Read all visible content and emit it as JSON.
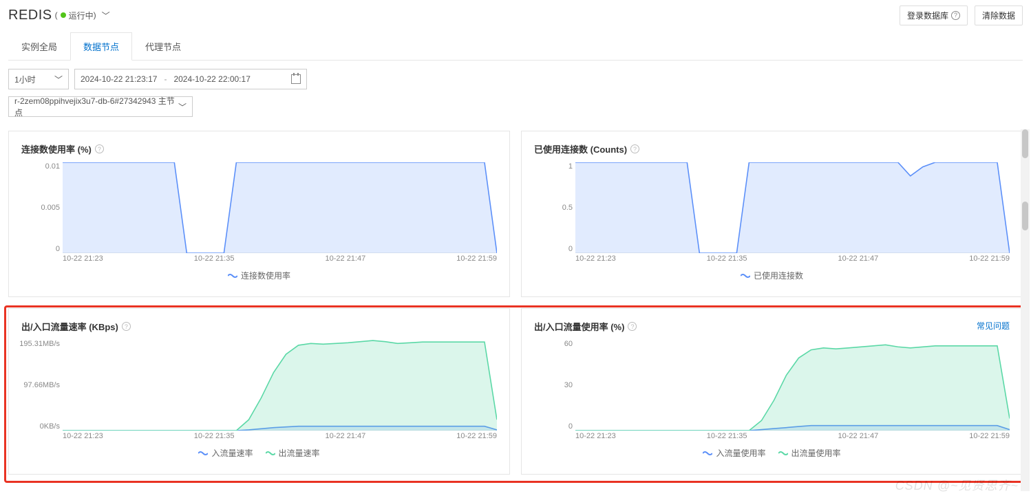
{
  "header": {
    "title": "REDIS",
    "status_text": "运行中",
    "login_btn": "登录数据库",
    "clear_btn": "清除数据"
  },
  "tabs": [
    {
      "label": "实例全局",
      "active": false
    },
    {
      "label": "数据节点",
      "active": true
    },
    {
      "label": "代理节点",
      "active": false
    }
  ],
  "filters": {
    "period": "1小时",
    "start": "2024-10-22 21:23:17",
    "end": "2024-10-22 22:00:17",
    "node": "r-2zem08ppihvejix3u7-db-6#27342943 主节点"
  },
  "faq_label": "常见问题",
  "watermark": "CSDN @~见贤思齐~",
  "chart_data": [
    {
      "id": "conn_rate",
      "type": "area",
      "title": "连接数使用率 (%)",
      "ylabel": "",
      "xlabel": "",
      "y_ticks": [
        "0.01",
        "0.005",
        "0"
      ],
      "x_ticks": [
        "10-22 21:23",
        "10-22 21:35",
        "10-22 21:47",
        "10-22 21:59"
      ],
      "ylim": [
        0,
        0.01
      ],
      "series": [
        {
          "name": "连接数使用率",
          "color": "#5b8ff9",
          "values": [
            0.01,
            0.01,
            0.01,
            0.01,
            0.01,
            0.01,
            0.01,
            0.01,
            0.01,
            0.01,
            0.0,
            0.0,
            0.0,
            0.0,
            0.01,
            0.01,
            0.01,
            0.01,
            0.01,
            0.01,
            0.01,
            0.01,
            0.01,
            0.01,
            0.01,
            0.01,
            0.01,
            0.01,
            0.01,
            0.01,
            0.01,
            0.01,
            0.01,
            0.01,
            0.01,
            0.0
          ]
        }
      ]
    },
    {
      "id": "conn_used",
      "type": "area",
      "title": "已使用连接数 (Counts)",
      "y_ticks": [
        "1",
        "0.5",
        "0"
      ],
      "x_ticks": [
        "10-22 21:23",
        "10-22 21:35",
        "10-22 21:47",
        "10-22 21:59"
      ],
      "ylim": [
        0,
        1
      ],
      "series": [
        {
          "name": "已使用连接数",
          "color": "#5b8ff9",
          "values": [
            1,
            1,
            1,
            1,
            1,
            1,
            1,
            1,
            1,
            1,
            0,
            0,
            0,
            0,
            1,
            1,
            1,
            1,
            1,
            1,
            1,
            1,
            1,
            1,
            1,
            1,
            1,
            0.85,
            0.95,
            1,
            1,
            1,
            1,
            1,
            1,
            0
          ]
        }
      ]
    },
    {
      "id": "traffic_rate",
      "type": "area",
      "title": "出/入口流量速率 (KBps)",
      "y_ticks": [
        "195.31MB/s",
        "97.66MB/s",
        "0KB/s"
      ],
      "x_ticks": [
        "10-22 21:23",
        "10-22 21:35",
        "10-22 21:47",
        "10-22 21:59"
      ],
      "ylim": [
        0,
        250
      ],
      "series": [
        {
          "name": "入流量速率",
          "color": "#5b8ff9",
          "values": [
            0,
            0,
            0,
            0,
            0,
            0,
            0,
            0,
            0,
            0,
            0,
            0,
            0,
            0,
            0,
            2,
            5,
            8,
            10,
            12,
            12,
            12,
            12,
            12,
            12,
            12,
            12,
            12,
            12,
            12,
            12,
            12,
            12,
            12,
            12,
            2
          ]
        },
        {
          "name": "出流量速率",
          "color": "#5ad8a6",
          "values": [
            0,
            0,
            0,
            0,
            0,
            0,
            0,
            0,
            0,
            0,
            0,
            0,
            0,
            0,
            0,
            30,
            90,
            160,
            210,
            235,
            240,
            238,
            240,
            242,
            245,
            248,
            245,
            240,
            242,
            244,
            244,
            244,
            244,
            244,
            244,
            30
          ]
        }
      ]
    },
    {
      "id": "traffic_usage",
      "type": "area",
      "title": "出/入口流量使用率 (%)",
      "y_ticks": [
        "60",
        "30",
        "0"
      ],
      "x_ticks": [
        "10-22 21:23",
        "10-22 21:35",
        "10-22 21:47",
        "10-22 21:59"
      ],
      "ylim": [
        0,
        90
      ],
      "series": [
        {
          "name": "入流量使用率",
          "color": "#5b8ff9",
          "values": [
            0,
            0,
            0,
            0,
            0,
            0,
            0,
            0,
            0,
            0,
            0,
            0,
            0,
            0,
            0,
            1,
            2,
            3,
            4,
            5,
            5,
            5,
            5,
            5,
            5,
            5,
            5,
            5,
            5,
            5,
            5,
            5,
            5,
            5,
            5,
            1
          ]
        },
        {
          "name": "出流量使用率",
          "color": "#5ad8a6",
          "values": [
            0,
            0,
            0,
            0,
            0,
            0,
            0,
            0,
            0,
            0,
            0,
            0,
            0,
            0,
            0,
            10,
            30,
            55,
            72,
            80,
            82,
            81,
            82,
            83,
            84,
            85,
            83,
            82,
            83,
            84,
            84,
            84,
            84,
            84,
            84,
            12
          ]
        }
      ],
      "faq": true
    }
  ]
}
